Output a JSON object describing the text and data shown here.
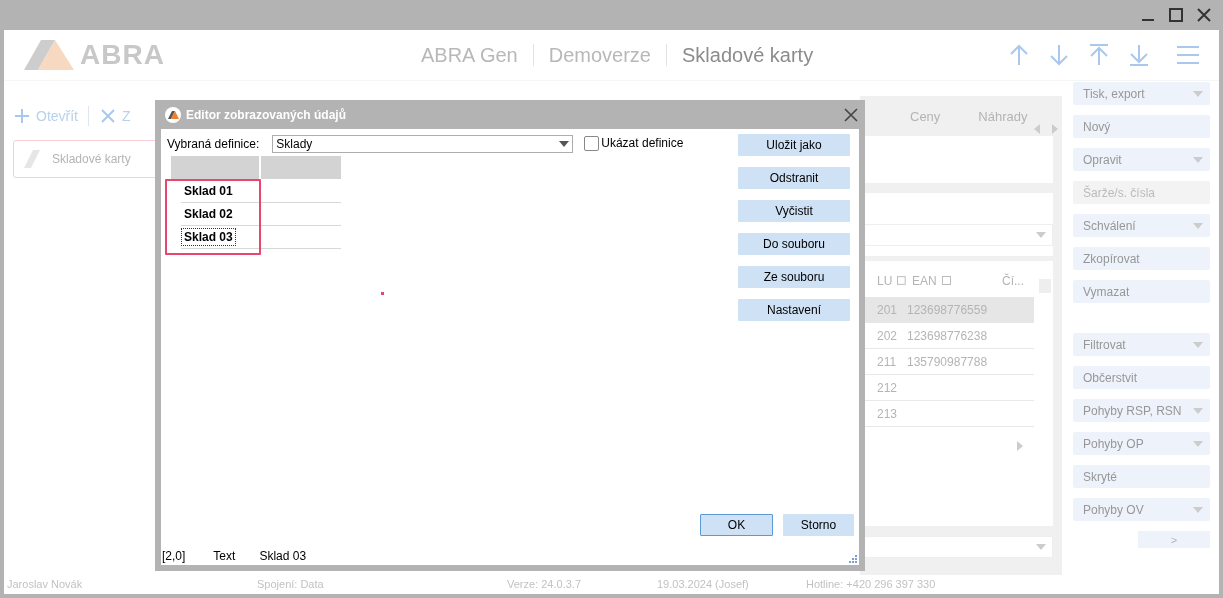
{
  "header": {
    "logo_text": "ABRA",
    "breadcrumb": [
      {
        "label": "ABRA Gen",
        "current": false
      },
      {
        "label": "Demoverze",
        "current": false
      },
      {
        "label": "Skladové karty",
        "current": true
      }
    ]
  },
  "left_panel": {
    "toolbar": [
      {
        "label": "Otevřít",
        "kind": "add"
      },
      {
        "label": "Z",
        "kind": "close"
      }
    ],
    "card": {
      "label": "Skladové karty",
      "selected": true
    }
  },
  "center": {
    "tabs": [
      {
        "label": "Ceny"
      },
      {
        "label": "Náhrady"
      }
    ],
    "table": {
      "columns": [
        {
          "label": "LU",
          "filter": true
        },
        {
          "label": "EAN",
          "filter": true
        },
        {
          "label": "Čí...",
          "filter": false
        }
      ],
      "rows": [
        {
          "lu": "201",
          "ean": "123698776559",
          "selected": true
        },
        {
          "lu": "202",
          "ean": "123698776238",
          "selected": false
        },
        {
          "lu": "211",
          "ean": "135790987788",
          "selected": false
        },
        {
          "lu": "212",
          "selected": false
        },
        {
          "lu": "213",
          "selected": false
        }
      ]
    }
  },
  "actions": [
    {
      "label": "Tisk, export",
      "dropdown": true,
      "disabled": false,
      "gap_before": false
    },
    {
      "label": "Nový",
      "dropdown": false,
      "disabled": false,
      "gap_before": false
    },
    {
      "label": "Opravit",
      "dropdown": true,
      "disabled": false,
      "gap_before": false
    },
    {
      "label": "Šarže/s. čísla",
      "dropdown": false,
      "disabled": true,
      "gap_before": false
    },
    {
      "label": "Schválení",
      "dropdown": true,
      "disabled": false,
      "gap_before": false
    },
    {
      "label": "Zkopírovat",
      "dropdown": false,
      "disabled": false,
      "gap_before": false
    },
    {
      "label": "Vymazat",
      "dropdown": false,
      "disabled": false,
      "gap_before": false
    },
    {
      "label": "Filtrovat",
      "dropdown": true,
      "disabled": false,
      "gap_before": true
    },
    {
      "label": "Občerstvit",
      "dropdown": false,
      "disabled": false,
      "gap_before": false
    },
    {
      "label": "Pohyby RSP, RSN",
      "dropdown": true,
      "disabled": false,
      "gap_before": false
    },
    {
      "label": "Pohyby OP",
      "dropdown": true,
      "disabled": false,
      "gap_before": false
    },
    {
      "label": "Skryté",
      "dropdown": false,
      "disabled": false,
      "gap_before": false
    },
    {
      "label": "Pohyby OV",
      "dropdown": true,
      "disabled": false,
      "gap_before": false
    }
  ],
  "more_button": ">",
  "status_bar": [
    "Jaroslav Novák",
    "Spojení: Data",
    "Verze: 24.0.3.7",
    "19.03.2024 (Josef)",
    "Hotline: +420 296 397 330"
  ],
  "dialog": {
    "title": "Editor zobrazovaných údajů",
    "definition": {
      "label": "Vybraná definice:",
      "value": "Sklady"
    },
    "show_definition": {
      "label": "Ukázat definice",
      "checked": false
    },
    "grid": {
      "column_highlighted": true,
      "rows": [
        {
          "label": "Sklad 01",
          "focused": false
        },
        {
          "label": "Sklad 02",
          "focused": false
        },
        {
          "label": "Sklad 03",
          "focused": true
        }
      ]
    },
    "buttons": [
      "Uložit jako",
      "Odstranit",
      "Vyčistit",
      "Do souboru",
      "Ze souboru",
      "Nastavení"
    ],
    "ok": "OK",
    "cancel": "Storno",
    "status": [
      "[2,0]",
      "Text",
      "Sklad 03"
    ]
  }
}
